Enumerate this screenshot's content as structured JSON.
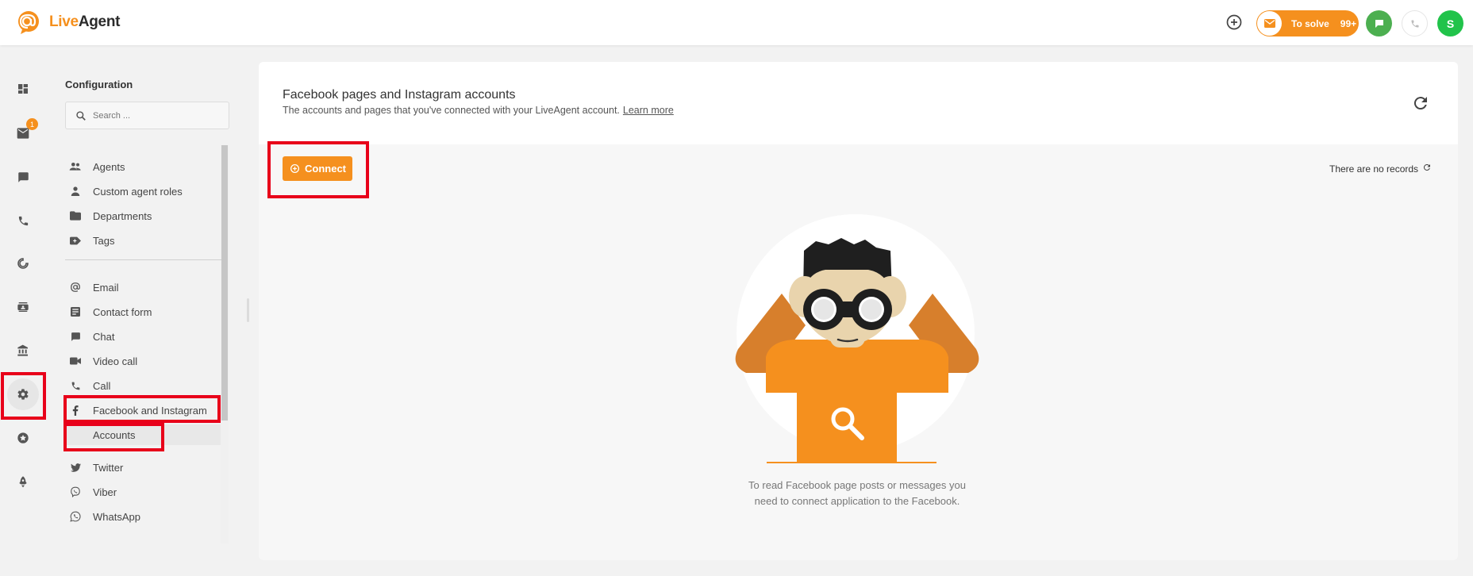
{
  "app": {
    "logo_live": "Live",
    "logo_agent": "Agent"
  },
  "topbar": {
    "to_solve_label": "To solve",
    "to_solve_count": "99+",
    "user_initial": "S"
  },
  "iconbar": {
    "email_badge": "1"
  },
  "config": {
    "title": "Configuration",
    "search_placeholder": "Search ...",
    "items_group1": [
      {
        "label": "Agents",
        "icon": "agents-icon"
      },
      {
        "label": "Custom agent roles",
        "icon": "person-icon"
      },
      {
        "label": "Departments",
        "icon": "folder-icon"
      },
      {
        "label": "Tags",
        "icon": "tag-icon"
      }
    ],
    "items_group2": [
      {
        "label": "Email",
        "icon": "at-icon"
      },
      {
        "label": "Contact form",
        "icon": "form-icon"
      },
      {
        "label": "Chat",
        "icon": "chat-icon"
      },
      {
        "label": "Video call",
        "icon": "video-icon"
      },
      {
        "label": "Call",
        "icon": "phone-icon"
      },
      {
        "label": "Facebook and Instagram",
        "icon": "facebook-icon"
      },
      {
        "label": "Accounts",
        "icon": ""
      },
      {
        "label": "Twitter",
        "icon": "twitter-icon"
      },
      {
        "label": "Viber",
        "icon": "viber-icon"
      },
      {
        "label": "WhatsApp",
        "icon": "whatsapp-icon"
      }
    ]
  },
  "main": {
    "title": "Facebook pages and Instagram accounts",
    "subtitle": "The accounts and pages that you've connected with your LiveAgent account.",
    "learn_more": "Learn more",
    "connect_label": "Connect",
    "no_records": "There are no records",
    "empty_line1": "To read Facebook page posts or messages you",
    "empty_line2": "need to connect application to the Facebook."
  },
  "colors": {
    "accent": "#f5901e",
    "highlight": "#e8001a",
    "green": "#4caf50"
  }
}
